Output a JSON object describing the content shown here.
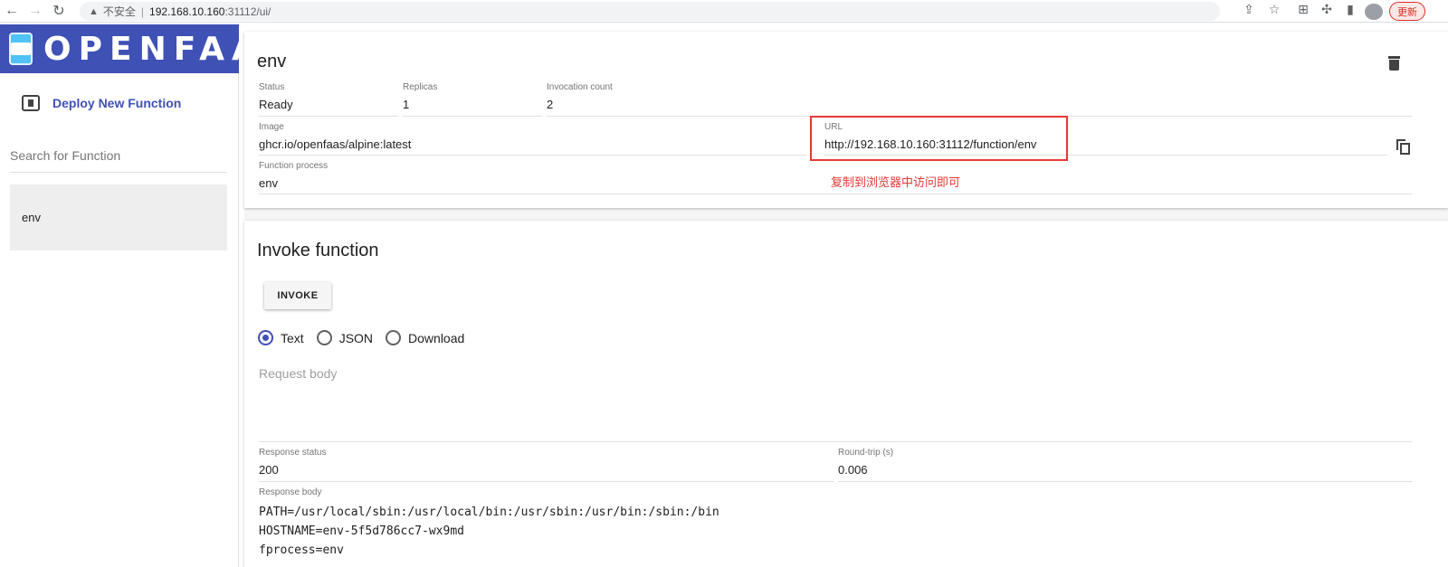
{
  "browser": {
    "insecure_label": "不安全",
    "url_host": "192.168.10.160",
    "url_path": ":31112/ui/",
    "update_label": "更新"
  },
  "sidebar": {
    "brand": "OPENFAAS",
    "deploy_label": "Deploy New Function",
    "search_placeholder": "Search for Function",
    "functions": [
      {
        "name": "env"
      }
    ]
  },
  "function": {
    "name": "env",
    "status_label": "Status",
    "status": "Ready",
    "replicas_label": "Replicas",
    "replicas": "1",
    "invocations_label": "Invocation count",
    "invocations": "2",
    "image_label": "Image",
    "image": "ghcr.io/openfaas/alpine:latest",
    "url_label": "URL",
    "url": "http://192.168.10.160:31112/function/env",
    "process_label": "Function process",
    "process": "env",
    "annotation": "复制到浏览器中访问即可"
  },
  "invoke": {
    "title": "Invoke function",
    "button": "INVOKE",
    "formats": [
      "Text",
      "JSON",
      "Download"
    ],
    "selected_format": "Text",
    "request_placeholder": "Request body",
    "response_status_label": "Response status",
    "response_status": "200",
    "roundtrip_label": "Round-trip (s)",
    "roundtrip": "0.006",
    "response_body_label": "Response body",
    "response_lines": [
      "PATH=/usr/local/sbin:/usr/local/bin:/usr/sbin:/usr/bin:/sbin:/bin",
      "HOSTNAME=env-5f5d786cc7-wx9md",
      "fprocess=env"
    ]
  },
  "colors": {
    "brand": "#3f51b5",
    "annotation": "#e53935"
  }
}
